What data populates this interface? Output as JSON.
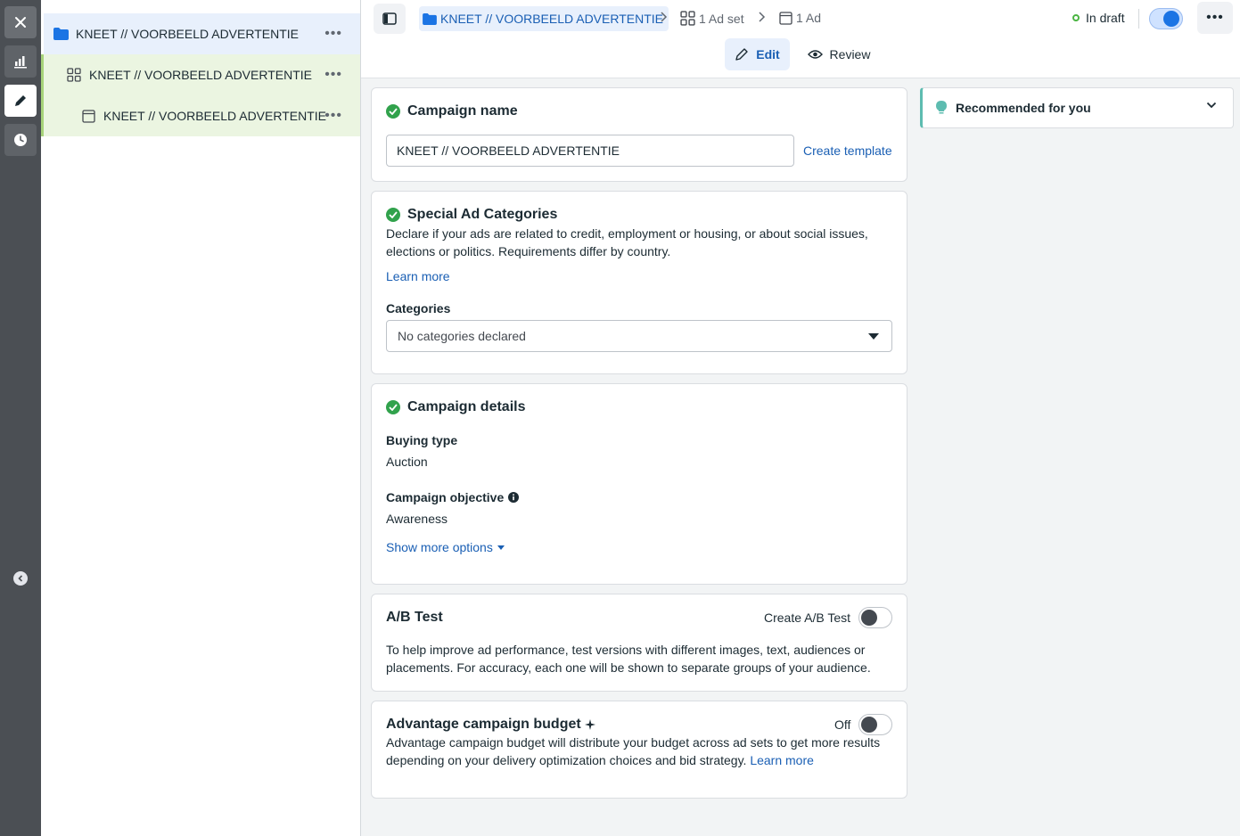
{
  "rail": {
    "buttons": [
      {
        "name": "close",
        "icon": "close-icon"
      },
      {
        "name": "reporting",
        "icon": "bar-chart-icon"
      },
      {
        "name": "edit",
        "icon": "pencil-icon",
        "active": true
      },
      {
        "name": "history",
        "icon": "clock-icon"
      }
    ],
    "collapse_icon": "chevron-left-icon"
  },
  "tree": {
    "campaign": {
      "label": "KNEET // VOORBEELD ADVERTENTIE",
      "icon": "folder-icon"
    },
    "adset": {
      "label": "KNEET // VOORBEELD ADVERTENTIE",
      "icon": "grid-icon"
    },
    "ad": {
      "label": "KNEET // VOORBEELD ADVERTENTIE",
      "icon": "ad-icon"
    }
  },
  "topbar": {
    "campaign_crumb": "KNEET // VOORBEELD ADVERTENTIE",
    "adset_crumb": "1 Ad set",
    "ad_crumb": "1 Ad",
    "status": "In draft",
    "toggle_on": true,
    "modes": {
      "edit": "Edit",
      "review": "Review"
    }
  },
  "campaign_name": {
    "title": "Campaign name",
    "value": "KNEET // VOORBEELD ADVERTENTIE",
    "create_template": "Create template"
  },
  "special_categories": {
    "title": "Special Ad Categories",
    "description": "Declare if your ads are related to credit, employment or housing, or about social issues, elections or politics. Requirements differ by country.",
    "learn_more": "Learn more",
    "categories_label": "Categories",
    "categories_value": "No categories declared"
  },
  "campaign_details": {
    "title": "Campaign details",
    "buying_type_label": "Buying type",
    "buying_type_value": "Auction",
    "objective_label": "Campaign objective",
    "objective_value": "Awareness",
    "show_more": "Show more options"
  },
  "ab_test": {
    "title": "A/B Test",
    "toggle_label": "Create A/B Test",
    "toggle_on": false,
    "description": "To help improve ad performance, test versions with different images, text, audiences or placements. For accuracy, each one will be shown to separate groups of your audience."
  },
  "advantage_budget": {
    "title": "Advantage campaign budget",
    "toggle_label": "Off",
    "toggle_on": false,
    "description": "Advantage campaign budget will distribute your budget across ad sets to get more results depending on your delivery optimization choices and bid strategy.",
    "learn_more": "Learn more"
  },
  "recommendations": {
    "title": "Recommended for you"
  },
  "colors": {
    "accent": "#1a5fb4",
    "success": "#31a24c",
    "rail": "#4b4f54",
    "selected_bg": "#e8f0fc",
    "adset_bg": "#ebf5e1"
  }
}
